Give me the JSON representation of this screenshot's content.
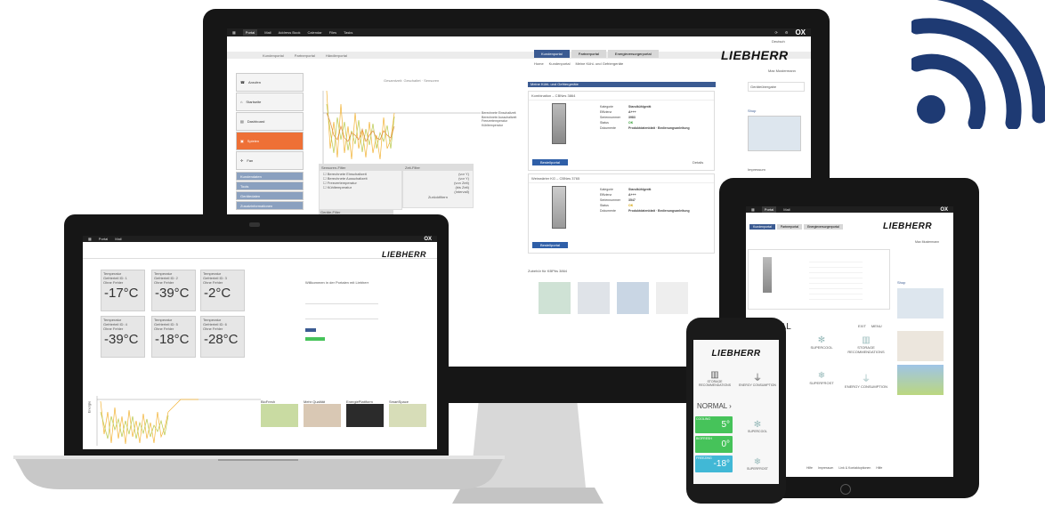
{
  "colors": {
    "ox_blue": "#1e3a73",
    "liebherr_orange": "#ee7036",
    "green": "#46c35a",
    "cyan": "#41b8d6"
  },
  "wifi_icon": "wifi-icon",
  "monitor": {
    "topbar": {
      "tabs": [
        "Portal",
        "Mail",
        "Address Book",
        "Calendar",
        "Files",
        "Tasks"
      ],
      "active": "Portal",
      "brand": "OX",
      "user": "Deutsch"
    },
    "subnav": [
      "Kundenportal",
      "Partnerportal",
      "Händlerportal"
    ],
    "portal_tabs": [
      "Kundenportal",
      "Partnerportal",
      "Energieversorgerportal"
    ],
    "logo": "LIEBHERR",
    "user_label": "Max Mustermann",
    "breadcrumb": [
      "Home",
      "Kundenportal",
      "Meine Kühl- und Gefriergeräte"
    ],
    "side_items": [
      "Anrufen",
      "Startseite",
      "Dashboard",
      "Spielen",
      "Fan",
      "Kundendaten",
      "Tools",
      "Gerätedaten",
      "Zusatzinformationen"
    ],
    "chart_title": "Gesamtzeit: Geschaltet · Sensoren",
    "legend": [
      "Berechnete Einschaltzeit",
      "Berechnete Ausschaltzeit",
      "Freezertemperatur",
      "Kühltemperatur"
    ],
    "section_header": "Meine Kühl- und Gefriergeräte",
    "products": [
      {
        "name": "Kombination – CBNes 3864",
        "rows": [
          [
            "Kategorie",
            "Standkühlgerät"
          ],
          [
            "Effizienz",
            "A+++"
          ],
          [
            "Seriennummer",
            "3983"
          ],
          [
            "Status",
            "OK"
          ],
          [
            "Dokumente",
            "Produktdatenblatt · Bedienungsanleitung"
          ]
        ],
        "action": "Bestellportal",
        "extra": "Details"
      },
      {
        "name": "Weinwärter KG – CBNes 3765",
        "rows": [
          [
            "Kategorie",
            "Standkühlgerät"
          ],
          [
            "Effizienz",
            "A+++"
          ],
          [
            "Seriennummer",
            "3547"
          ],
          [
            "Status",
            "OK"
          ],
          [
            "Dokumente",
            "Produktdatenblatt · Bedienungsanleitung"
          ]
        ],
        "action": "Bestellportal",
        "extra": "Details"
      }
    ],
    "accessories_title": "Zubehör für KBPbs 3864",
    "filters": {
      "sensor_title": "Sensoren-Filter",
      "sensors": [
        "Berechnete Einschaltzeit",
        "Berechnete Ausschaltzeit",
        "Freezertemperatur",
        "Kühltemperatur"
      ],
      "time_title": "Zeit-Filter",
      "time_rows": [
        "(vor Y)",
        "(vor Y)",
        "(von Zeit)",
        "(bis Zeit)",
        "(Intervall)"
      ],
      "apply": "Zurückfiltern",
      "device_title": "Geräte-Filter"
    },
    "sidebar_right": {
      "box1": "Geräteübergabe",
      "shop": "Shop",
      "impress": "Impressum"
    }
  },
  "laptop": {
    "logo": "LIEBHERR",
    "temps": [
      {
        "label": "Temperatur",
        "id": "Gefrierteil ID: 1",
        "status": "Ohne Fehler",
        "value": "-17°C"
      },
      {
        "label": "Temperatur",
        "id": "Gefrierteil ID: 2",
        "status": "Ohne Fehler",
        "value": "-39°C"
      },
      {
        "label": "Temperatur",
        "id": "Gefrierteil ID: 3",
        "status": "Ohne Fehler",
        "value": "-2°C"
      },
      {
        "label": "Temperatur",
        "id": "Gefrierteil ID: 4",
        "status": "Ohne Fehler",
        "value": "-39°C"
      },
      {
        "label": "Temperatur",
        "id": "Gefrierteil ID: 5",
        "status": "Ohne Fehler",
        "value": "-18°C"
      },
      {
        "label": "Temperatur",
        "id": "Gefrierteil ID: 6",
        "status": "Ohne Fehler",
        "value": "-28°C"
      }
    ],
    "welcome": "Willkommen in der Portalen mit Liebherr",
    "news": [
      "BioFresh",
      "Mehr Qualität",
      "EnergiePlattform",
      "SmartSpace"
    ],
    "chart_ylabel": "Energie"
  },
  "tablet": {
    "logo": "LIEBHERR",
    "user_label": "Max Mustermann",
    "mode": "NORMAL",
    "mode_tabs": [
      "EXIT",
      "MENU"
    ],
    "tiles": [
      "SUPERCOOL",
      "STORAGE RECOMMENDATIONS",
      "SUPERFROST",
      "ENERGY CONSUMPTION"
    ],
    "footer": [
      "Hilfe",
      "Impressum",
      "Link & Kontaktoptionen",
      "Hilfe"
    ],
    "shop": "Shop"
  },
  "phone": {
    "logo": "LIEBHERR",
    "icons": [
      "STORAGE RECOMMENDATIONS",
      "ENERGY CONSUMPTION"
    ],
    "mode": "NORMAL",
    "zones": [
      {
        "label": "COOLING",
        "value": "5°",
        "color": "#46c35a",
        "action": "SUPERCOOL"
      },
      {
        "label": "BIOFRESH",
        "value": "0°",
        "color": "#46c35a",
        "action": ""
      },
      {
        "label": "FREEZING",
        "value": "-18°",
        "color": "#41b8d6",
        "action": "SUPERFROST"
      }
    ]
  }
}
